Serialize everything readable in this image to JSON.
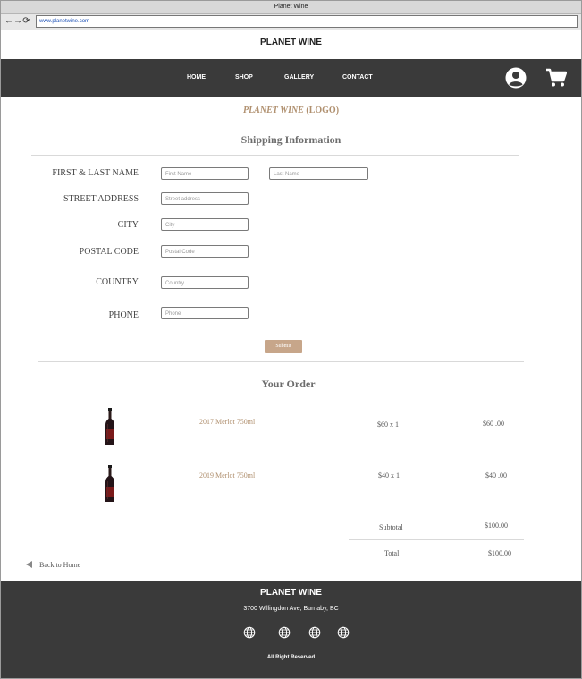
{
  "browser": {
    "window_title": "Planet Wine",
    "url": "www.planetwine.com",
    "nav_glyphs": [
      "←",
      "→",
      "⟳"
    ]
  },
  "site": {
    "brand": "PLANET WINE",
    "nav": [
      "HOME",
      "SHOP",
      "GALLERY",
      "CONTACT"
    ],
    "logo_text": "PLANET WINE",
    "logo_paren": "(LOGO)"
  },
  "shipping": {
    "heading": "Shipping Information",
    "fields": [
      {
        "label": "FIRST & LAST NAME",
        "placeholder": "First Name",
        "placeholder2": "Last Name"
      },
      {
        "label": "STREET ADDRESS",
        "placeholder": "Street address"
      },
      {
        "label": "CITY",
        "placeholder": "City"
      },
      {
        "label": "POSTAL CODE",
        "placeholder": "Postal Code"
      },
      {
        "label": "COUNTRY",
        "placeholder": "Country"
      },
      {
        "label": "PHONE",
        "placeholder": "Phone"
      }
    ],
    "submit_label": "Submit"
  },
  "order": {
    "heading": "Your Order",
    "items": [
      {
        "name": "2017 Merlot 750ml",
        "qty": "$60 x 1",
        "price": "$60 .00"
      },
      {
        "name": "2019 Merlot 750ml",
        "qty": "$40 x 1",
        "price": "$40 .00"
      }
    ],
    "subtotal_label": "Subtotal",
    "subtotal_value": "$100.00",
    "total_label": "Total",
    "total_value": "$100.00"
  },
  "back_link": "Back to Home",
  "footer": {
    "brand": "PLANET WINE",
    "address": "3700 Willingdon Ave, Burnaby, BC",
    "copyright": "All Right Reserved",
    "social_icons": [
      "globe-icon",
      "globe-icon",
      "globe-icon",
      "globe-icon"
    ]
  },
  "colors": {
    "nav_bg": "#3a3a3a",
    "accent": "#b0906f",
    "button": "#c7a68a"
  }
}
